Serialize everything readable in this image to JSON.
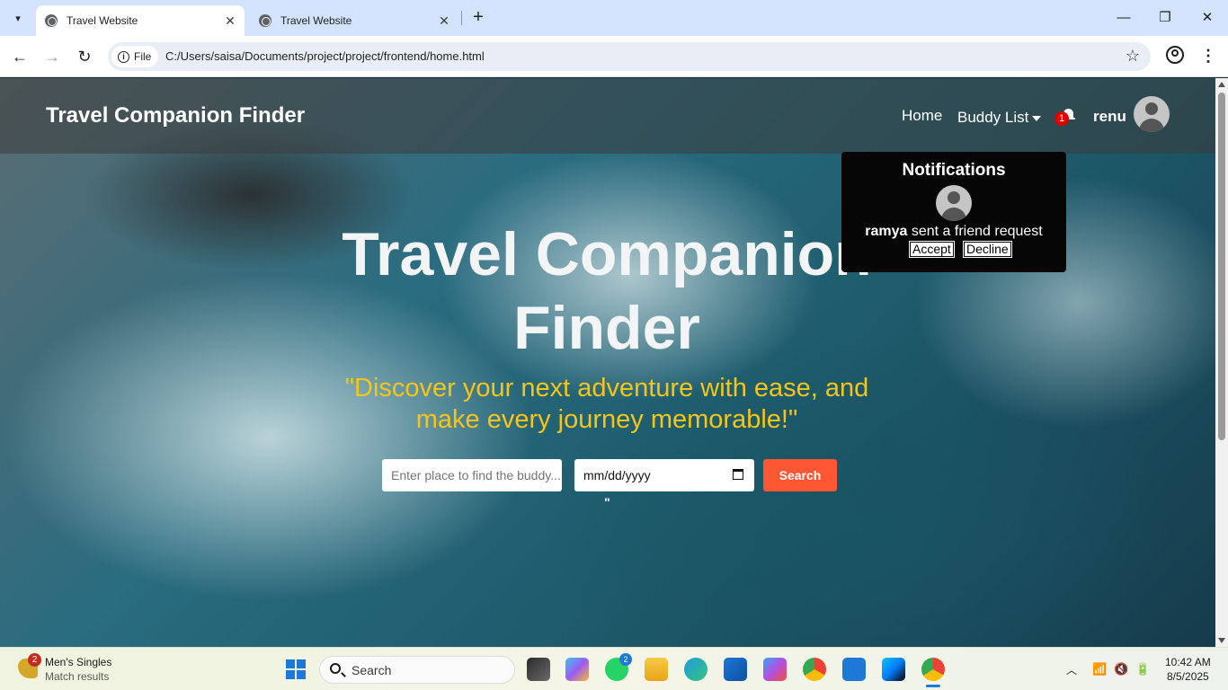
{
  "browser": {
    "tabs": [
      {
        "title": "Travel Website",
        "active": true
      },
      {
        "title": "Travel Website",
        "active": false
      }
    ],
    "new_tab_symbol": "+",
    "window_controls": {
      "minimize": "—",
      "maximize": "❐",
      "close": "✕"
    },
    "nav": {
      "back": "←",
      "forward": "→",
      "reload": "↻"
    },
    "file_chip": "File",
    "url": "C:/Users/saisa/Documents/project/project/frontend/home.html",
    "star": "☆",
    "menu": "⋮"
  },
  "site": {
    "brand": "Travel Companion Finder",
    "nav_home": "Home",
    "nav_buddy": "Buddy List",
    "notification_count": "1",
    "username": "renu",
    "hero_title": "Travel Companion Finder",
    "hero_quote": "\"Discover your next adventure with ease, and make every journey memorable!\"",
    "search": {
      "place_placeholder": "Enter place to find the buddy...",
      "date_placeholder": "mm/dd/yyyy",
      "button_label": "Search"
    },
    "stray_text": "\"",
    "notifications": {
      "title": "Notifications",
      "sender": "ramya",
      "message": " sent a friend request",
      "accept_label": "Accept",
      "decline_label": "Decline"
    }
  },
  "taskbar": {
    "widget": {
      "badge": "2",
      "title": "Men's Singles",
      "subtitle": "Match results"
    },
    "search_label": "Search",
    "whatsapp_badge": "2",
    "clock_time": "10:42 AM",
    "clock_date": "8/5/2025",
    "apps": [
      "task-view",
      "copilot",
      "whatsapp",
      "file-explorer",
      "edge",
      "store",
      "m365",
      "chrome",
      "vscode",
      "webstorm",
      "chrome-active"
    ]
  }
}
